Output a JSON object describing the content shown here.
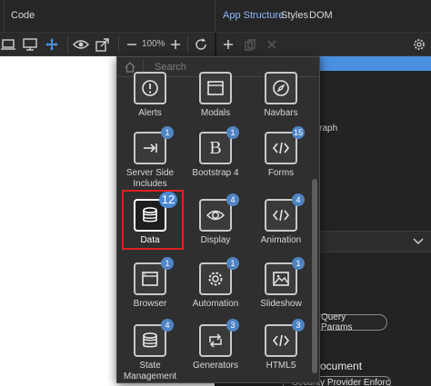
{
  "topbar": {
    "code_tab": "Code",
    "right_tabs": [
      "App Structure",
      "Styles",
      "DOM"
    ]
  },
  "toolbar": {
    "zoom": "100%",
    "icons": [
      "laptop-icon",
      "monitor-icon",
      "move-icon",
      "eye-icon",
      "share-icon",
      "minus-icon",
      "plus-icon",
      "refresh-icon"
    ],
    "right_icons": [
      "plus-icon",
      "copy-icon",
      "close-icon",
      "settings-icon"
    ]
  },
  "right_panel": {
    "paragraph_fragment": "agraph",
    "pill_query_params": "Query Params",
    "heading_document": "ocument",
    "pill_security": "Security Provider Enforcer"
  },
  "popup": {
    "search_placeholder": "Search",
    "items": [
      {
        "label": "Alerts",
        "badge": "",
        "icon": "alert-icon"
      },
      {
        "label": "Modals",
        "badge": "",
        "icon": "modal-icon"
      },
      {
        "label": "Navbars",
        "badge": "",
        "icon": "compass-icon"
      },
      {
        "label": "Server Side Includes",
        "badge": "1",
        "icon": "include-icon"
      },
      {
        "label": "Bootstrap 4",
        "badge": "1",
        "icon": "bootstrap-icon"
      },
      {
        "label": "Forms",
        "badge": "15",
        "icon": "code-icon"
      },
      {
        "label": "Data",
        "badge": "12",
        "icon": "database-icon"
      },
      {
        "label": "Display",
        "badge": "4",
        "icon": "eye-icon"
      },
      {
        "label": "Animation",
        "badge": "4",
        "icon": "code-icon"
      },
      {
        "label": "Browser",
        "badge": "1",
        "icon": "browser-icon"
      },
      {
        "label": "Automation",
        "badge": "1",
        "icon": "gear-icon"
      },
      {
        "label": "Slideshow",
        "badge": "1",
        "icon": "image-icon"
      },
      {
        "label": "State Management",
        "badge": "4",
        "icon": "database-icon"
      },
      {
        "label": "Generators",
        "badge": "3",
        "icon": "repeat-icon"
      },
      {
        "label": "HTML5",
        "badge": "3",
        "icon": "code-icon"
      }
    ]
  },
  "colors": {
    "accent": "#4a90e2",
    "badge": "#4f84c4",
    "selection_outline": "#e02020"
  }
}
